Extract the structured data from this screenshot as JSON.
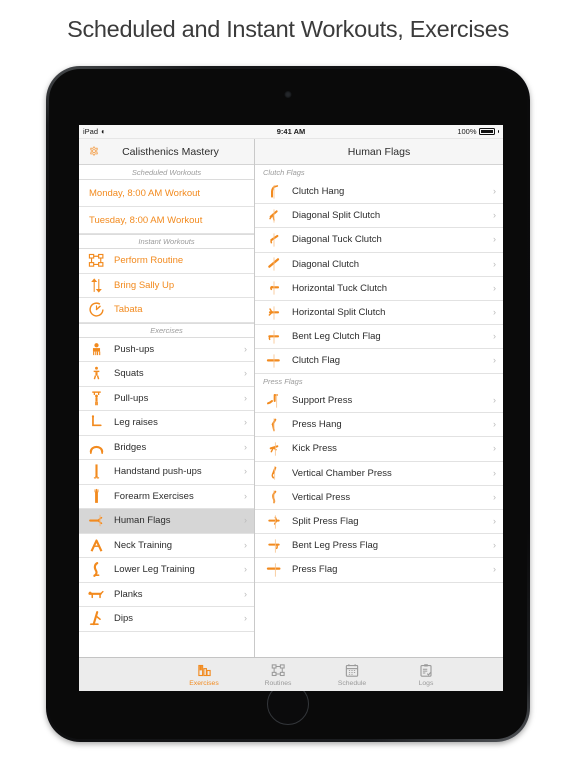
{
  "page": {
    "title": "Scheduled and Instant Workouts, Exercises"
  },
  "colors": {
    "accent": "#f28a1e",
    "selected_row_bg": "#d6d6d6",
    "nav_bar_bg": "#f6f6f6",
    "tab_bar_bg": "#ececec",
    "section_text": "#9b9b9b"
  },
  "status_bar": {
    "carrier": "iPad",
    "wifi_icon": "wifi-icon",
    "time": "9:41 AM",
    "battery_percent": "100%",
    "battery_icon": "battery-full-icon"
  },
  "sidebar": {
    "nav": {
      "settings_icon": "gear-icon",
      "title": "Calisthenics Mastery"
    },
    "sections": [
      {
        "header": "Scheduled Workouts",
        "items": [
          {
            "label": "Monday, 8:00 AM Workout",
            "accent": true,
            "icon": "",
            "chevron": false
          },
          {
            "label": "Tuesday, 8:00 AM Workout",
            "accent": true,
            "icon": "",
            "chevron": false
          }
        ]
      },
      {
        "header": "Instant Workouts",
        "items": [
          {
            "label": "Perform Routine",
            "accent": true,
            "icon": "routine-flowchart-icon",
            "chevron": false
          },
          {
            "label": "Bring Sally Up",
            "accent": true,
            "icon": "up-down-arrows-icon",
            "chevron": false
          },
          {
            "label": "Tabata",
            "accent": true,
            "icon": "timer-icon",
            "chevron": false
          }
        ]
      },
      {
        "header": "Exercises",
        "items": [
          {
            "label": "Push-ups",
            "accent": false,
            "icon": "pushup-figure-icon",
            "chevron": true,
            "selected": false
          },
          {
            "label": "Squats",
            "accent": false,
            "icon": "squat-figure-icon",
            "chevron": true,
            "selected": false
          },
          {
            "label": "Pull-ups",
            "accent": false,
            "icon": "pullup-figure-icon",
            "chevron": true,
            "selected": false
          },
          {
            "label": "Leg raises",
            "accent": false,
            "icon": "legraise-figure-icon",
            "chevron": true,
            "selected": false
          },
          {
            "label": "Bridges",
            "accent": false,
            "icon": "bridge-figure-icon",
            "chevron": true,
            "selected": false
          },
          {
            "label": "Handstand push-ups",
            "accent": false,
            "icon": "handstand-figure-icon",
            "chevron": true,
            "selected": false
          },
          {
            "label": "Forearm Exercises",
            "accent": false,
            "icon": "forearm-figure-icon",
            "chevron": true,
            "selected": false
          },
          {
            "label": "Human Flags",
            "accent": false,
            "icon": "humanflag-figure-icon",
            "chevron": true,
            "selected": true
          },
          {
            "label": "Neck Training",
            "accent": false,
            "icon": "neck-figure-icon",
            "chevron": true,
            "selected": false
          },
          {
            "label": "Lower Leg Training",
            "accent": false,
            "icon": "lowerleg-figure-icon",
            "chevron": true,
            "selected": false
          },
          {
            "label": "Planks",
            "accent": false,
            "icon": "plank-figure-icon",
            "chevron": true,
            "selected": false
          },
          {
            "label": "Dips",
            "accent": false,
            "icon": "dips-figure-icon",
            "chevron": true,
            "selected": false
          }
        ]
      }
    ]
  },
  "detail": {
    "nav": {
      "title": "Human Flags"
    },
    "sections": [
      {
        "header": "Clutch Flags",
        "items": [
          {
            "label": "Clutch Hang",
            "icon": "clutch-hang-icon"
          },
          {
            "label": "Diagonal Split Clutch",
            "icon": "diagonal-split-clutch-icon"
          },
          {
            "label": "Diagonal Tuck Clutch",
            "icon": "diagonal-tuck-clutch-icon"
          },
          {
            "label": "Diagonal Clutch",
            "icon": "diagonal-clutch-icon"
          },
          {
            "label": "Horizontal Tuck Clutch",
            "icon": "horizontal-tuck-clutch-icon"
          },
          {
            "label": "Horizontal Split Clutch",
            "icon": "horizontal-split-clutch-icon"
          },
          {
            "label": "Bent Leg Clutch Flag",
            "icon": "bent-leg-clutch-flag-icon"
          },
          {
            "label": "Clutch Flag",
            "icon": "clutch-flag-icon"
          }
        ]
      },
      {
        "header": "Press Flags",
        "items": [
          {
            "label": "Support Press",
            "icon": "support-press-icon"
          },
          {
            "label": "Press Hang",
            "icon": "press-hang-icon"
          },
          {
            "label": "Kick Press",
            "icon": "kick-press-icon"
          },
          {
            "label": "Vertical Chamber Press",
            "icon": "vertical-chamber-press-icon"
          },
          {
            "label": "Vertical Press",
            "icon": "vertical-press-icon"
          },
          {
            "label": "Split Press Flag",
            "icon": "split-press-flag-icon"
          },
          {
            "label": "Bent Leg Press Flag",
            "icon": "bent-leg-press-flag-icon"
          },
          {
            "label": "Press Flag",
            "icon": "press-flag-icon"
          }
        ]
      }
    ]
  },
  "tab_bar": {
    "tabs": [
      {
        "label": "Exercises",
        "icon": "exercises-icon",
        "active": true
      },
      {
        "label": "Routines",
        "icon": "routines-icon",
        "active": false
      },
      {
        "label": "Schedule",
        "icon": "schedule-calendar-icon",
        "active": false
      },
      {
        "label": "Logs",
        "icon": "logs-clipboard-icon",
        "active": false
      }
    ]
  }
}
